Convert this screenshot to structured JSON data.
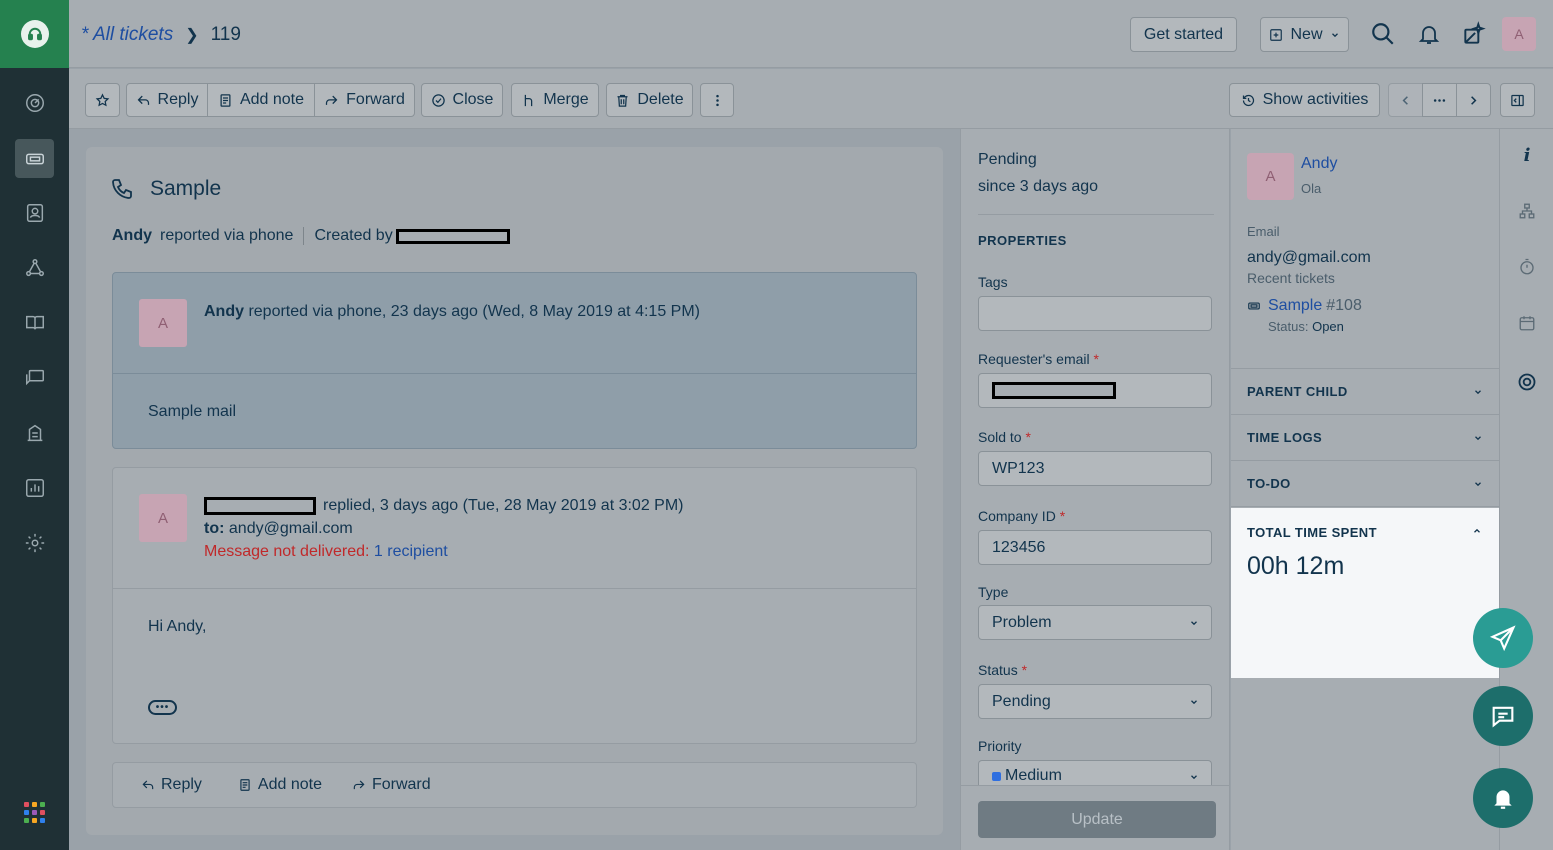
{
  "header": {
    "breadcrumb_link": "* All tickets",
    "breadcrumb_current": "119",
    "get_started": "Get started",
    "new_label": "New",
    "user_avatar": "A"
  },
  "toolbar": {
    "reply": "Reply",
    "add_note": "Add note",
    "forward": "Forward",
    "close": "Close",
    "merge": "Merge",
    "delete": "Delete",
    "show_activities": "Show activities"
  },
  "ticket": {
    "title": "Sample",
    "requester": "Andy",
    "reported_via": "reported via phone",
    "created_by_label": "Created by"
  },
  "messages": [
    {
      "avatar": "A",
      "author": "Andy",
      "header_text": "reported via phone, 23 days ago (Wed, 8 May 2019 at 4:15 PM)",
      "body": "Sample mail"
    },
    {
      "avatar": "A",
      "header_text": "replied, 3 days ago (Tue, 28 May 2019 at 3:02 PM)",
      "to_label": "to:",
      "to_value": "andy@gmail.com",
      "error_text": "Message not delivered:",
      "error_link": "1 recipient",
      "body": "Hi Andy,"
    }
  ],
  "reply_bar": {
    "reply": "Reply",
    "add_note": "Add note",
    "forward": "Forward"
  },
  "properties": {
    "status_title": "Pending",
    "status_since": "since 3 days ago",
    "section_title": "PROPERTIES",
    "tags_label": "Tags",
    "requester_email_label": "Requester's email",
    "sold_to_label": "Sold to",
    "sold_to_value": "WP123",
    "company_id_label": "Company ID",
    "company_id_value": "123456",
    "type_label": "Type",
    "type_value": "Problem",
    "status_label": "Status",
    "status_value": "Pending",
    "priority_label": "Priority",
    "priority_value": "Medium",
    "priority_color": "#2f6fe0",
    "update_button": "Update",
    "required_mark": "*"
  },
  "contact": {
    "avatar": "A",
    "name": "Andy",
    "company": "Ola",
    "email_label": "Email",
    "email_value": "andy@gmail.com",
    "recent_tickets_label": "Recent tickets",
    "recent_ticket_title": "Sample",
    "recent_ticket_id": "#108",
    "recent_ticket_status_label": "Status:",
    "recent_ticket_status": "Open",
    "sections": [
      "PARENT CHILD",
      "TIME LOGS",
      "TO-DO"
    ],
    "total_time_label": "TOTAL TIME SPENT",
    "total_time_value": "00h 12m"
  }
}
